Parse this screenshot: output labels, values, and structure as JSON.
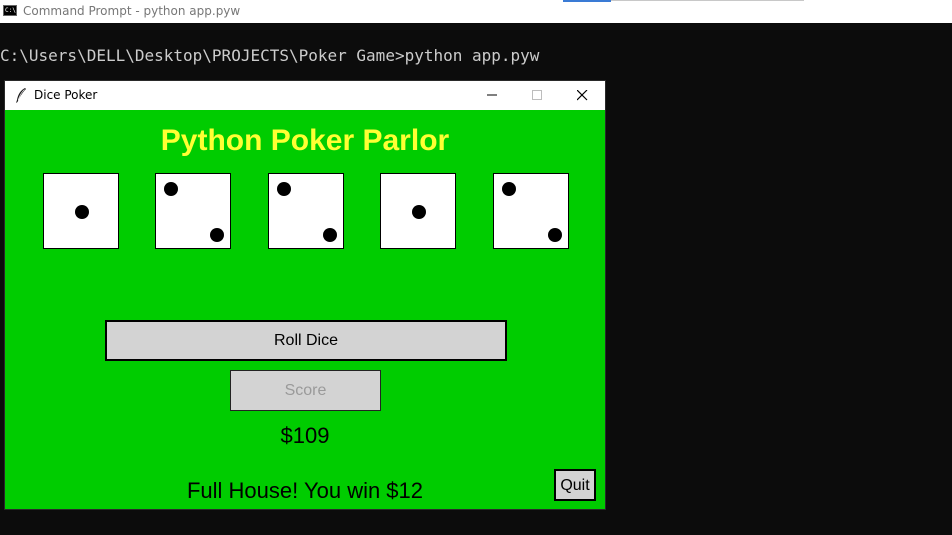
{
  "cmd": {
    "title": "Command Prompt - python  app.pyw",
    "icon_text": "C:\\",
    "line": "C:\\Users\\DELL\\Desktop\\PROJECTS\\Poker Game>python app.pyw"
  },
  "window": {
    "title": "Dice Poker"
  },
  "game": {
    "title": "Python Poker Parlor",
    "dice": [
      1,
      2,
      2,
      1,
      2
    ],
    "roll_label": "Roll Dice",
    "score_label": "Score",
    "money": "$109",
    "message": "Full House! You win $12",
    "quit_label": "Quit"
  },
  "colors": {
    "table_green": "#00cc00",
    "title_yellow": "#ffff33",
    "button_gray": "#d3d3d3"
  }
}
